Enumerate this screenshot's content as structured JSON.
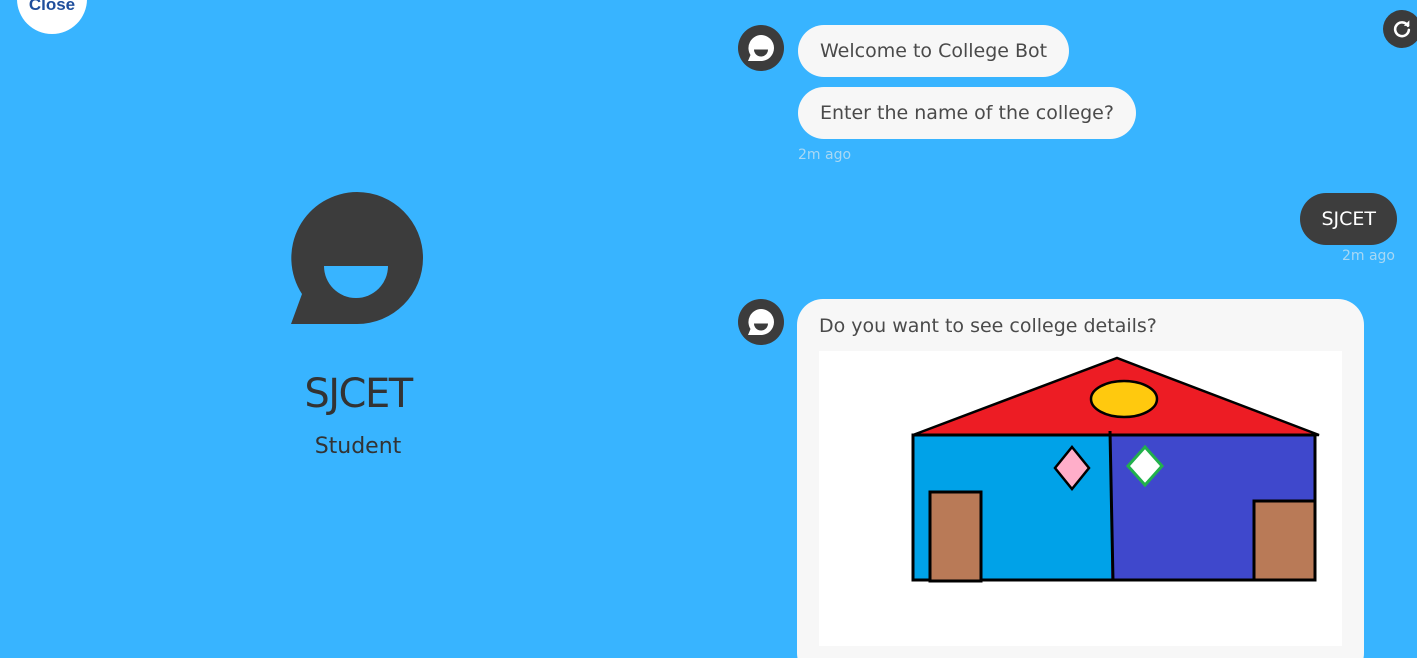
{
  "close_label": "Close",
  "profile": {
    "name": "SJCET",
    "role": "Student"
  },
  "chat": {
    "bot_msg_1": "Welcome to College Bot",
    "bot_msg_2": "Enter the name of the college?",
    "bot_time_1": "2m ago",
    "user_msg": "SJCET",
    "user_time": "2m ago",
    "bot_msg_3": "Do you want to see college details?"
  },
  "colors": {
    "background": "#38b4ff",
    "bubble_bot": "#f7f7f7",
    "bubble_user": "#3d3d3d",
    "avatar": "#3c3c3c"
  },
  "icons": {
    "close": "close-button",
    "refresh": "refresh-icon",
    "bot_avatar": "chat-bubble-smile-icon"
  }
}
